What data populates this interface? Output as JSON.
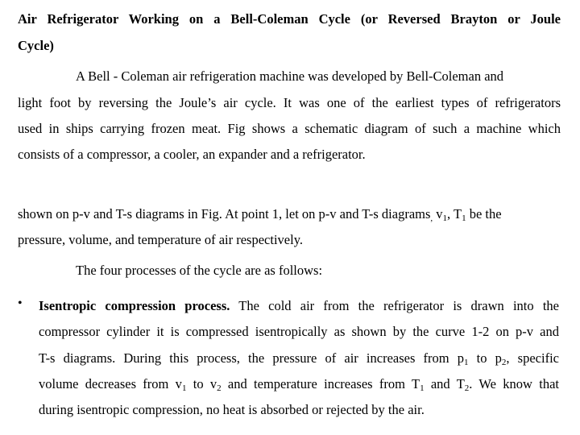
{
  "heading": {
    "line1": "Air Refrigerator Working on a Bell-Coleman Cycle (or Reversed Brayton or Joule",
    "line2": "Cycle)"
  },
  "para1": {
    "line1": "A Bell - Coleman air refrigeration machine was developed by Bell-Coleman and",
    "line2": "light foot by reversing the Joule’s air cycle. It was one of the earliest types of refrigerators",
    "line3": "used in ships carrying frozen meat. Fig shows a schematic diagram of such a machine which",
    "line4": "consists of a compressor, a cooler, an expander and a refrigerator."
  },
  "para2": {
    "line1_a": "shown on p-v and T-s diagrams in Fig. At point 1, let on p-v and T-s diagrams",
    "line1_comma": ",",
    "line1_v": "v",
    "line1_v_sub": "1",
    "line1_sep": ", T",
    "line1_t_sub": "1",
    "line1_end": " be the",
    "line2": "pressure, volume, and temperature of air respectively."
  },
  "para3": {
    "line1": "The four processes of the cycle are as follows:"
  },
  "bullet": {
    "marker": "•",
    "term": "Isentropic compression process.",
    "line1_rest": " The cold air from the refrigerator is drawn into the",
    "line2": "compressor cylinder it is compressed isentropically as shown by the curve 1-2 on p-v and",
    "line3_a": "T-s diagrams. During this process, the pressure of air increases from p",
    "line3_sub1": "1",
    "line3_b": " to p",
    "line3_sub2": "2",
    "line3_c": ", specific",
    "line4_a": "volume decreases from v",
    "line4_sub1": "1",
    "line4_b": " to v",
    "line4_sub2": "2",
    "line4_c": " and temperature increases from T",
    "line4_sub3": "1",
    "line4_d": " and T",
    "line4_sub4": "2",
    "line4_e": ". We know that",
    "line5": "during isentropic compression, no heat is absorbed or rejected by the air."
  }
}
